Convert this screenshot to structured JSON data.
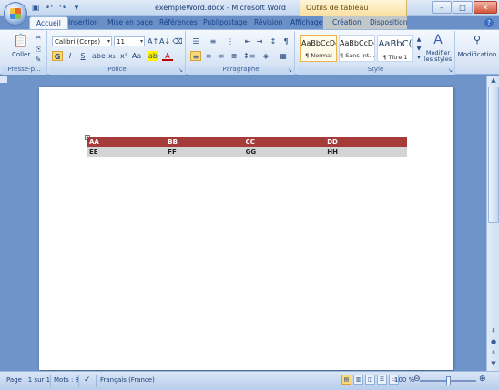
{
  "titlebar": {
    "document_title": "exempleWord.docx - Microsoft Word",
    "context_tools_label": "Outils de tableau",
    "minimize": "–",
    "maximize": "□",
    "close": "✕"
  },
  "tabs": [
    {
      "label": "Accueil",
      "active": true
    },
    {
      "label": "Insertion"
    },
    {
      "label": "Mise en page"
    },
    {
      "label": "Références"
    },
    {
      "label": "Publipostage"
    },
    {
      "label": "Révision"
    },
    {
      "label": "Affichage"
    },
    {
      "label": "Création"
    },
    {
      "label": "Disposition"
    }
  ],
  "ribbon": {
    "clipboard": {
      "paste_label": "Coller",
      "group_label": "Presse-p..."
    },
    "font": {
      "font_name": "Calibri (Corps)",
      "font_size": "11",
      "group_label": "Police"
    },
    "paragraph": {
      "group_label": "Paragraphe"
    },
    "styles": {
      "items": [
        {
          "sample": "AaBbCcDc",
          "name": "¶ Normal"
        },
        {
          "sample": "AaBbCcDc",
          "name": "¶ Sans int..."
        },
        {
          "sample": "AaBbC(",
          "name": "¶ Titre 1"
        }
      ],
      "change_styles_label": "Modifier les styles",
      "group_label": "Style"
    },
    "editing": {
      "label": "Modification"
    }
  },
  "document": {
    "table": {
      "header": [
        "AA",
        "BB",
        "CC",
        "DD"
      ],
      "rows": [
        [
          "EE",
          "FF",
          "GG",
          "HH"
        ]
      ]
    },
    "colors": {
      "header_bg": "#a53c3a",
      "row_bg": "#d4d4d4"
    }
  },
  "statusbar": {
    "page": "Page : 1 sur 1",
    "words": "Mots : 8",
    "language": "Français (France)",
    "zoom": "100 %"
  }
}
